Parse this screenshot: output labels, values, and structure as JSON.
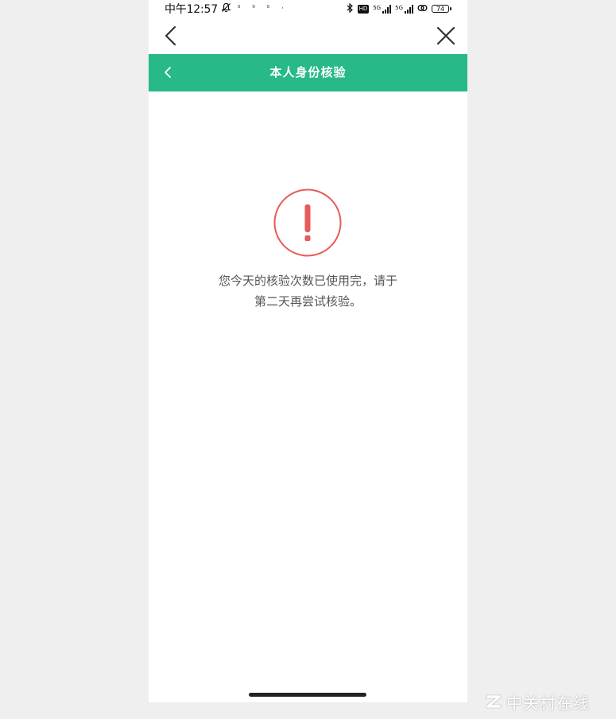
{
  "status_bar": {
    "time": "中午12:57",
    "battery": "74",
    "hd_label": "HD",
    "signal_tag": "5G"
  },
  "header": {
    "title": "本人身份核验"
  },
  "content": {
    "message_line1": "您今天的核验次数已使用完，请于",
    "message_line2": "第二天再尝试核验。"
  },
  "watermark": {
    "text": "中关村在线"
  },
  "colors": {
    "header_bg": "#27b987",
    "alert_red": "#e85a5a",
    "page_bg": "#efefef"
  }
}
